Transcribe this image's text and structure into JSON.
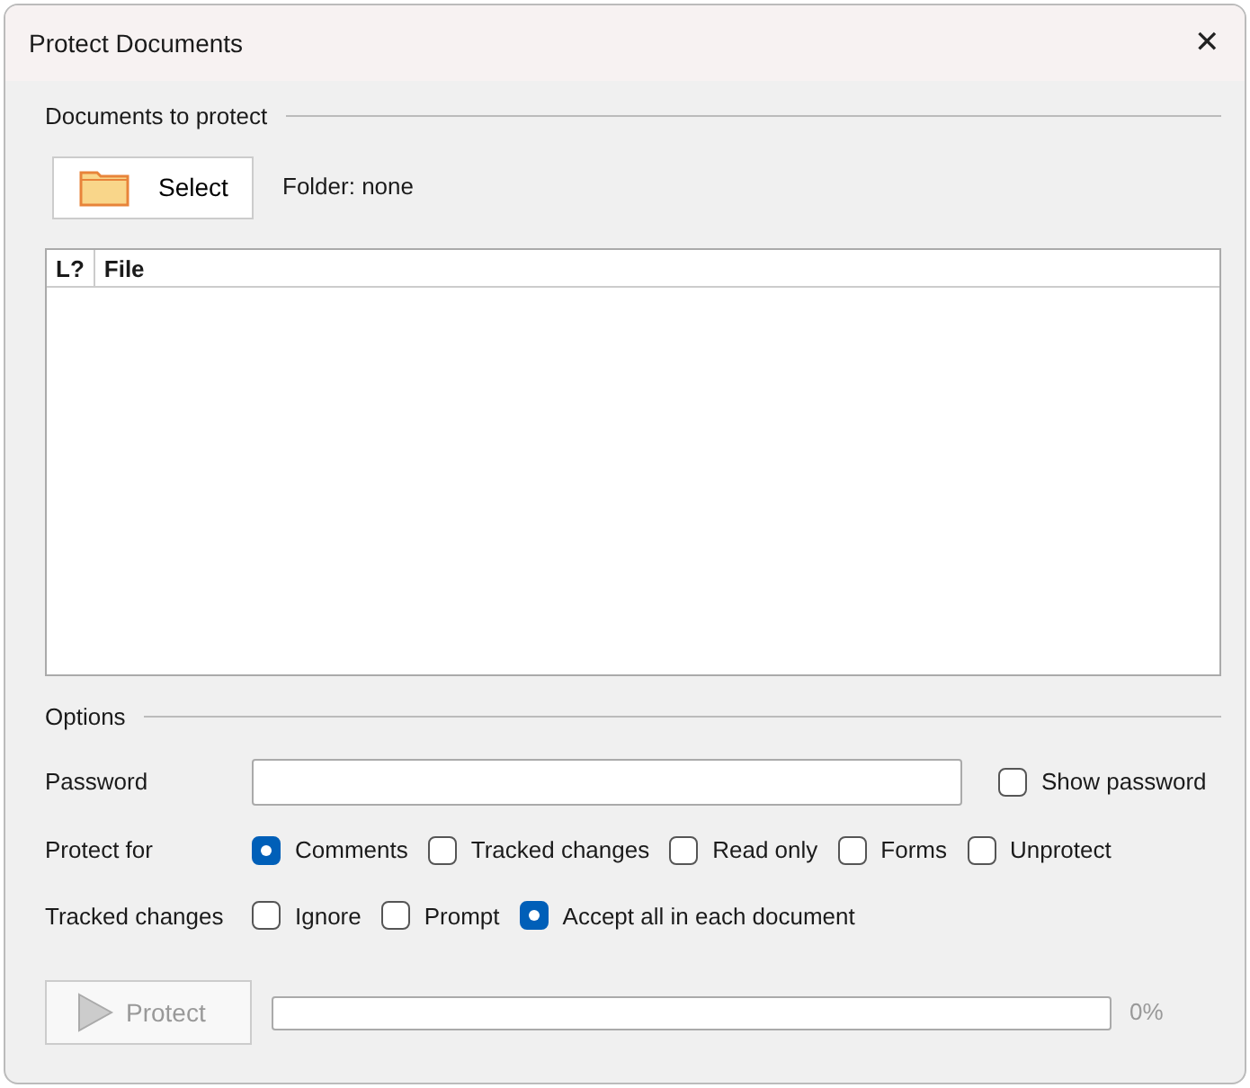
{
  "window": {
    "title": "Protect Documents",
    "close": "✕"
  },
  "documents": {
    "heading": "Documents to protect",
    "select_button": "Select",
    "folder_label": "Folder: none",
    "table": {
      "columns": [
        "L?",
        "File"
      ]
    }
  },
  "options": {
    "heading": "Options",
    "password": {
      "label": "Password",
      "show_password": {
        "label": "Show password",
        "checked": false
      }
    },
    "protect_for": {
      "label": "Protect for",
      "items": [
        {
          "label": "Comments",
          "checked": true
        },
        {
          "label": "Tracked changes",
          "checked": false
        },
        {
          "label": "Read only",
          "checked": false
        },
        {
          "label": "Forms",
          "checked": false
        },
        {
          "label": "Unprotect",
          "checked": false
        }
      ]
    },
    "tracked_changes": {
      "label": "Tracked changes",
      "items": [
        {
          "label": "Ignore",
          "checked": false
        },
        {
          "label": "Prompt",
          "checked": false
        },
        {
          "label": "Accept all in each document",
          "checked": true
        }
      ]
    }
  },
  "footer": {
    "protect_button": {
      "label": "Protect",
      "disabled": true
    },
    "progress": {
      "level": 0
    },
    "reading": "0%"
  }
}
